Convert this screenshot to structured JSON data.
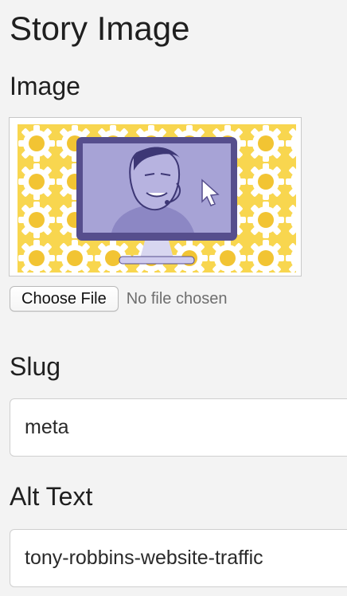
{
  "page": {
    "title": "Story Image"
  },
  "image_field": {
    "label": "Image",
    "preview_icon": "presenter-monitor-illustration",
    "colors": {
      "background_gears": "#f5c842",
      "monitor_frame": "#564e8d",
      "screen_fill": "#a7a3d6"
    },
    "file_button_label": "Choose File",
    "file_status": "No file chosen"
  },
  "slug_field": {
    "label": "Slug",
    "value": "meta"
  },
  "alt_field": {
    "label": "Alt Text",
    "value": "tony-robbins-website-traffic"
  }
}
